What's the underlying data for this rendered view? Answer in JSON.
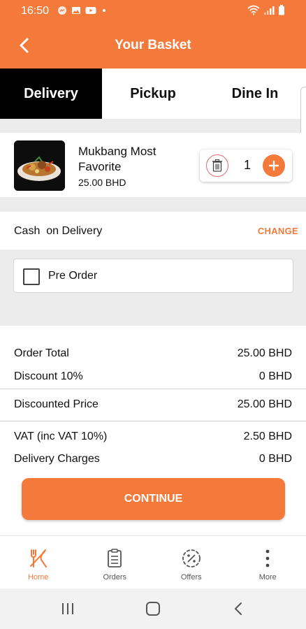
{
  "status_bar": {
    "time": "16:50",
    "left_icons": [
      "messenger-icon",
      "gallery-icon",
      "youtube-icon",
      "dot-icon"
    ],
    "right_icons": [
      "wifi-icon",
      "signal-icon",
      "battery-icon"
    ]
  },
  "header": {
    "title": "Your Basket",
    "background": "#f47a3c"
  },
  "tabs": [
    {
      "label": "Delivery",
      "active": true
    },
    {
      "label": "Pickup",
      "active": false
    },
    {
      "label": "Dine In",
      "active": false
    }
  ],
  "basket_item": {
    "name": "Mukbang Most Favorite",
    "price": "25.00 BHD",
    "quantity": "1"
  },
  "payment": {
    "method": "Cash  on Delivery",
    "change_label": "CHANGE"
  },
  "preorder": {
    "label": "Pre Order",
    "checked": false
  },
  "summary": {
    "order_total": {
      "label": "Order Total",
      "value": "25.00 BHD"
    },
    "discount": {
      "label": "Discount 10%",
      "value": "0 BHD"
    },
    "discounted_price": {
      "label": "Discounted Price",
      "value": "25.00 BHD"
    },
    "vat": {
      "label": "VAT (inc VAT 10%)",
      "value": "2.50 BHD"
    },
    "delivery_charges": {
      "label": "Delivery Charges",
      "value": "0 BHD"
    }
  },
  "continue_label": "CONTINUE",
  "bottom_nav": [
    {
      "label": "Home",
      "icon": "fork-knife-icon",
      "active": true
    },
    {
      "label": "Orders",
      "icon": "clipboard-icon",
      "active": false
    },
    {
      "label": "Offers",
      "icon": "percent-badge-icon",
      "active": false
    },
    {
      "label": "More",
      "icon": "more-vertical-icon",
      "active": false
    }
  ],
  "colors": {
    "accent": "#f47a3c",
    "active_tab": "#000000",
    "danger": "#e06a6a"
  }
}
